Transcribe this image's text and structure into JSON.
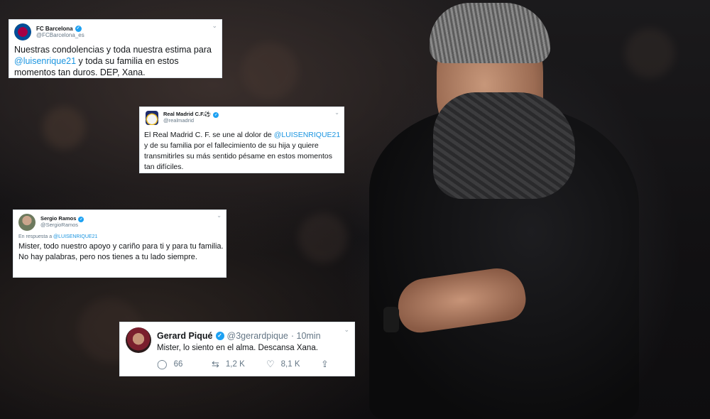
{
  "tweets": [
    {
      "display_name": "FC Barcelona",
      "handle": "@FCBarcelona_es",
      "body_before": "Nuestras condolencias y toda nuestra estima para ",
      "mention": "@luisenrique21",
      "body_after": " y toda su familia en estos momentos tan duros. DEP, Xana."
    },
    {
      "display_name": "Real Madrid C.F.⚽",
      "handle": "@realmadrid",
      "body_before": "El Real Madrid C. F. se une al dolor de ",
      "mention": "@LUISENRIQUE21",
      "body_after": " y de su familia por el fallecimiento de su hija y quiere transmitirles su más sentido pésame en estos momentos tan difíciles."
    },
    {
      "display_name": "Sergio Ramos",
      "handle": "@SergioRamos",
      "reply_prefix": "En respuesta a ",
      "reply_to": "@LUISENRIQUE21",
      "body": "Mister, todo nuestro apoyo y cariño para ti y para tu familia. No hay palabras, pero nos tienes a tu lado siempre."
    },
    {
      "display_name": "Gerard Piqué",
      "handle": "@3gerardpique",
      "time": "· 10min",
      "body": "Mister, lo siento en el alma. Descansa Xana.",
      "replies": "66",
      "retweets": "1,2 K",
      "likes": "8,1 K"
    }
  ],
  "icons": {
    "verified": "verified-badge-icon",
    "caret": "chevron-down-icon",
    "reply": "reply-icon",
    "retweet": "retweet-icon",
    "like": "heart-icon",
    "share": "share-icon"
  },
  "colors": {
    "twitter_blue": "#1da1f2",
    "mention": "#1b95e0",
    "secondary_text": "#657786"
  }
}
